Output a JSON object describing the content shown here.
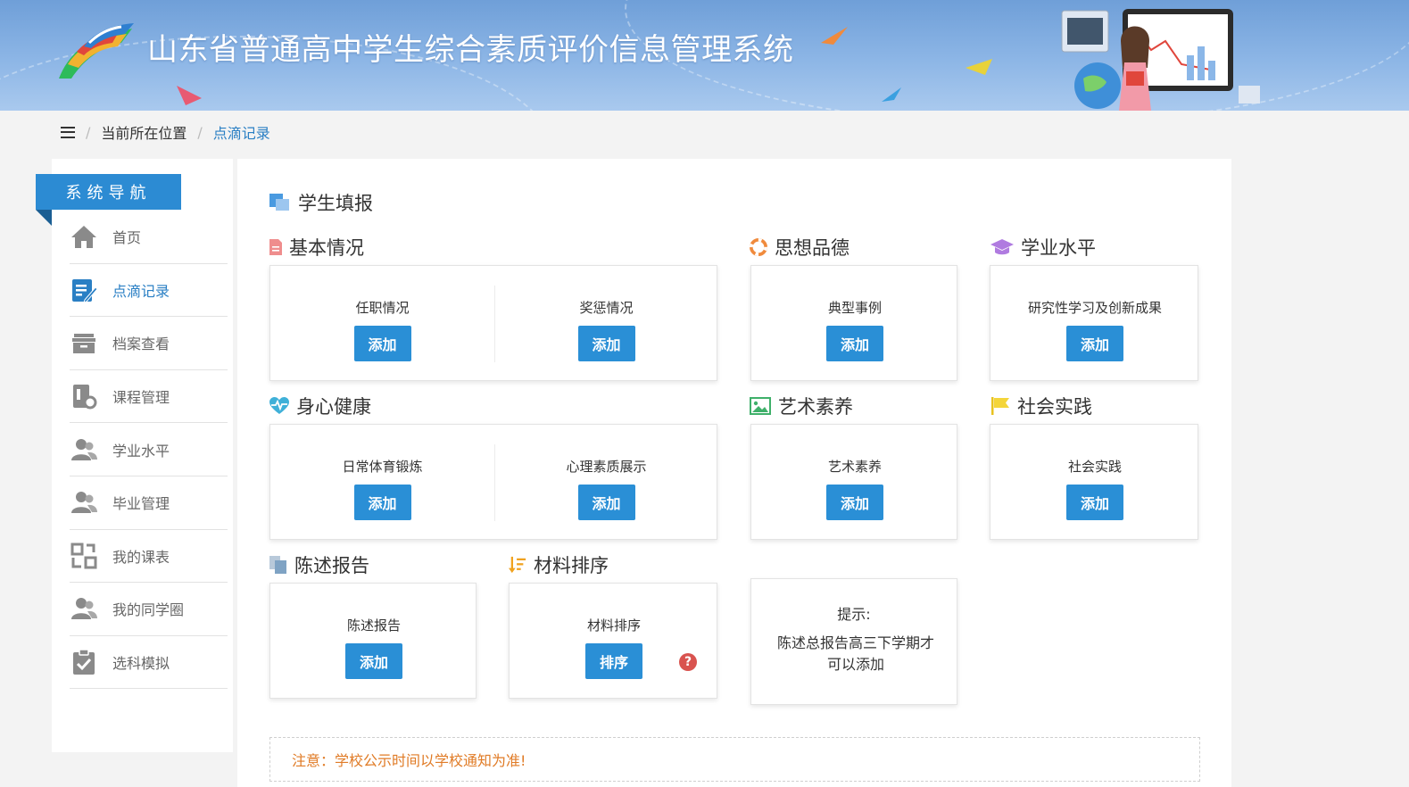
{
  "header": {
    "site_title": "山东省普通高中学生综合素质评价信息管理系统"
  },
  "breadcrumb": {
    "prefix": "当前所在位置",
    "current": "点滴记录"
  },
  "sidebar": {
    "heading": "系统导航",
    "items": [
      {
        "label": "首页",
        "icon": "home-icon"
      },
      {
        "label": "点滴记录",
        "icon": "edit-record-icon",
        "active": true
      },
      {
        "label": "档案查看",
        "icon": "archive-box-icon"
      },
      {
        "label": "课程管理",
        "icon": "course-settings-icon"
      },
      {
        "label": "学业水平",
        "icon": "users-icon"
      },
      {
        "label": "毕业管理",
        "icon": "users-icon"
      },
      {
        "label": "我的课表",
        "icon": "schedule-swap-icon"
      },
      {
        "label": "我的同学圈",
        "icon": "users-icon"
      },
      {
        "label": "选科模拟",
        "icon": "clipboard-check-icon"
      }
    ]
  },
  "main": {
    "title": "学生填报",
    "sections": {
      "basic": {
        "title": "基本情况",
        "items": [
          {
            "label": "任职情况",
            "button": "添加"
          },
          {
            "label": "奖惩情况",
            "button": "添加"
          }
        ]
      },
      "moral": {
        "title": "思想品德",
        "items": [
          {
            "label": "典型事例",
            "button": "添加"
          }
        ]
      },
      "academic": {
        "title": "学业水平",
        "items": [
          {
            "label": "研究性学习及创新成果",
            "button": "添加"
          }
        ]
      },
      "health": {
        "title": "身心健康",
        "items": [
          {
            "label": "日常体育锻炼",
            "button": "添加"
          },
          {
            "label": "心理素质展示",
            "button": "添加"
          }
        ]
      },
      "art": {
        "title": "艺术素养",
        "items": [
          {
            "label": "艺术素养",
            "button": "添加"
          }
        ]
      },
      "social": {
        "title": "社会实践",
        "items": [
          {
            "label": "社会实践",
            "button": "添加"
          }
        ]
      },
      "report": {
        "title": "陈述报告",
        "items": [
          {
            "label": "陈述报告",
            "button": "添加"
          }
        ]
      },
      "sort": {
        "title": "材料排序",
        "items": [
          {
            "label": "材料排序",
            "button": "排序"
          }
        ]
      }
    },
    "tip": {
      "title": "提示:",
      "body": "陈述总报告高三下学期才可以添加"
    },
    "notice": "注意：学校公示时间以学校通知为准!"
  },
  "colors": {
    "accent": "#2a8fd6",
    "nav_head": "#2c8bd3",
    "notice_text": "#e07b26",
    "help_badge": "#d9534f"
  }
}
